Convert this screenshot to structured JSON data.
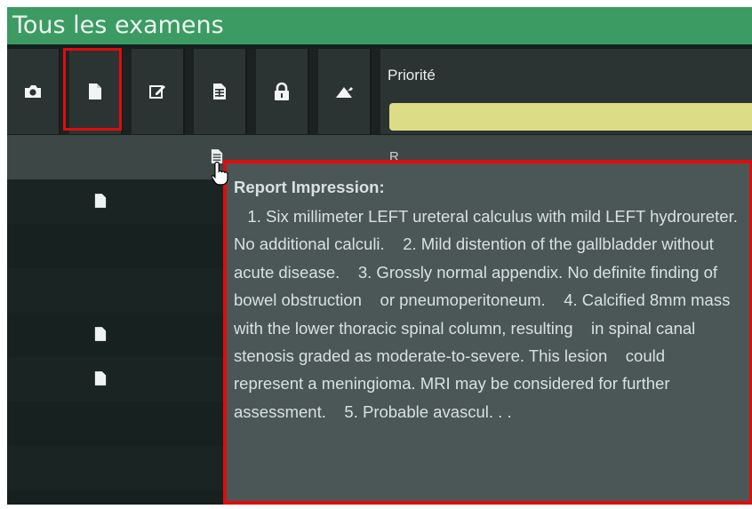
{
  "window": {
    "title": "Tous les examens"
  },
  "toolbar": {
    "buttons": [
      {
        "icon": "camera-icon"
      },
      {
        "icon": "document-icon"
      },
      {
        "icon": "edit-icon"
      },
      {
        "icon": "report-icon"
      },
      {
        "icon": "lock-icon"
      },
      {
        "icon": "pin-icon"
      }
    ],
    "priority": {
      "label": "Priorité",
      "value": ""
    }
  },
  "rows": [
    {
      "text": "R"
    }
  ],
  "tooltip": {
    "title": "Report Impression:",
    "body": "   1. Six millimeter LEFT ureteral calculus with mild LEFT hydroureter.    No additional calculi.    2. Mild distention of the gallbladder without acute disease.    3. Grossly normal appendix. No definite finding of bowel obstruction    or pneumoperitoneum.    4. Calcified 8mm mass with the lower thoracic spinal column, resulting    in spinal canal stenosis graded as moderate-to-severe. This lesion    could represent a meningioma. MRI may be considered for further    assessment.    5. Probable avascul. . ."
  },
  "colors": {
    "titlebar": "#3b9b63",
    "highlight": "#e00c0c",
    "priority_field": "#dcdc86",
    "tooltip_bg": "#4a5756"
  }
}
